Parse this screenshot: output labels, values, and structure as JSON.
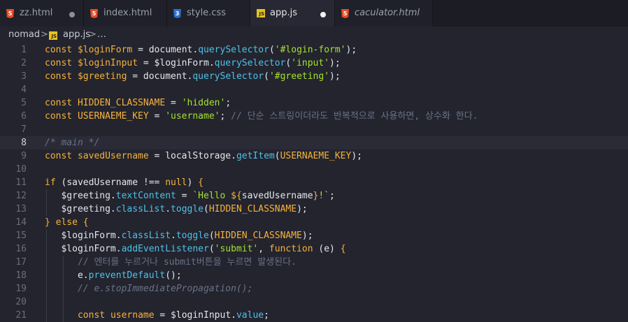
{
  "tabs": [
    {
      "name": "tab-zz-html",
      "label": "zz.html",
      "icon": "html5-icon",
      "modified": true,
      "italic": false,
      "active": false
    },
    {
      "name": "tab-index-html",
      "label": "index.html",
      "icon": "html5-icon",
      "modified": false,
      "italic": false,
      "active": false
    },
    {
      "name": "tab-style-css",
      "label": "style.css",
      "icon": "css3-icon",
      "modified": false,
      "italic": false,
      "active": false
    },
    {
      "name": "tab-app-js",
      "label": "app.js",
      "icon": "js-icon",
      "modified": true,
      "italic": false,
      "active": true
    },
    {
      "name": "tab-caculator-html",
      "label": "caculator.html",
      "icon": "html5-icon",
      "modified": false,
      "italic": true,
      "active": false
    }
  ],
  "breadcrumb": {
    "folder": "nomad",
    "file": "app.js",
    "more": "…",
    "separator": ">"
  },
  "editor": {
    "current_line": 8,
    "lines": [
      {
        "n": "1",
        "tokens": [
          [
            "kw",
            "const "
          ],
          [
            "vr",
            "$loginForm"
          ],
          [
            "op",
            " = "
          ],
          [
            "id",
            "document."
          ],
          [
            "fn",
            "querySelector"
          ],
          [
            "op",
            "("
          ],
          [
            "st",
            "'#login-form'"
          ],
          [
            "op",
            ");"
          ]
        ]
      },
      {
        "n": "2",
        "tokens": [
          [
            "kw",
            "const "
          ],
          [
            "vr",
            "$loginInput"
          ],
          [
            "op",
            " = "
          ],
          [
            "id",
            "$loginForm."
          ],
          [
            "fn",
            "querySelector"
          ],
          [
            "op",
            "("
          ],
          [
            "st",
            "'input'"
          ],
          [
            "op",
            ");"
          ]
        ]
      },
      {
        "n": "3",
        "tokens": [
          [
            "kw",
            "const "
          ],
          [
            "vr",
            "$greeting"
          ],
          [
            "op",
            " = "
          ],
          [
            "id",
            "document."
          ],
          [
            "fn",
            "querySelector"
          ],
          [
            "op",
            "("
          ],
          [
            "st",
            "'#greeting'"
          ],
          [
            "op",
            ");"
          ]
        ]
      },
      {
        "n": "4",
        "tokens": []
      },
      {
        "n": "5",
        "tokens": [
          [
            "kw",
            "const "
          ],
          [
            "vr",
            "HIDDEN_CLASSNAME"
          ],
          [
            "op",
            " = "
          ],
          [
            "st",
            "'hidden'"
          ],
          [
            "op",
            ";"
          ]
        ]
      },
      {
        "n": "6",
        "tokens": [
          [
            "kw",
            "const "
          ],
          [
            "vr",
            "USERNAEME_KEY"
          ],
          [
            "op",
            " = "
          ],
          [
            "st",
            "'username'"
          ],
          [
            "op",
            "; "
          ],
          [
            "cmko",
            "// 단순 스트링이더라도 반복적으로 사용하면, 상수화 한다."
          ]
        ]
      },
      {
        "n": "7",
        "tokens": []
      },
      {
        "n": "8",
        "tokens": [
          [
            "cm",
            "/* main */"
          ]
        ]
      },
      {
        "n": "9",
        "tokens": [
          [
            "kw",
            "const "
          ],
          [
            "vr",
            "savedUsername"
          ],
          [
            "op",
            " = "
          ],
          [
            "id",
            "localStorage."
          ],
          [
            "fn",
            "getItem"
          ],
          [
            "op",
            "("
          ],
          [
            "vr",
            "USERNAEME_KEY"
          ],
          [
            "op",
            ");"
          ]
        ]
      },
      {
        "n": "10",
        "tokens": []
      },
      {
        "n": "11",
        "tokens": [
          [
            "kw",
            "if "
          ],
          [
            "op",
            "("
          ],
          [
            "id",
            "savedUsername "
          ],
          [
            "op",
            "!== "
          ],
          [
            "kw",
            "null"
          ],
          [
            "op",
            ") "
          ],
          [
            "br",
            "{"
          ]
        ]
      },
      {
        "n": "12",
        "tokens": [
          [
            "op",
            "   "
          ],
          [
            "id",
            "$greeting."
          ],
          [
            "fn",
            "textContent"
          ],
          [
            "op",
            " = "
          ],
          [
            "st",
            "`Hello "
          ],
          [
            "kw",
            "${"
          ],
          [
            "id",
            "savedUsername"
          ],
          [
            "kw",
            "}"
          ],
          [
            "st",
            "!`"
          ],
          [
            "op",
            ";"
          ]
        ]
      },
      {
        "n": "13",
        "tokens": [
          [
            "op",
            "   "
          ],
          [
            "id",
            "$greeting."
          ],
          [
            "fn",
            "classList"
          ],
          [
            "op",
            "."
          ],
          [
            "fn",
            "toggle"
          ],
          [
            "op",
            "("
          ],
          [
            "vr",
            "HIDDEN_CLASSNAME"
          ],
          [
            "op",
            ");"
          ]
        ]
      },
      {
        "n": "14",
        "tokens": [
          [
            "br",
            "}"
          ],
          [
            "kw",
            " else "
          ],
          [
            "br",
            "{"
          ]
        ]
      },
      {
        "n": "15",
        "tokens": [
          [
            "op",
            "   "
          ],
          [
            "id",
            "$loginForm."
          ],
          [
            "fn",
            "classList"
          ],
          [
            "op",
            "."
          ],
          [
            "fn",
            "toggle"
          ],
          [
            "op",
            "("
          ],
          [
            "vr",
            "HIDDEN_CLASSNAME"
          ],
          [
            "op",
            ");"
          ]
        ]
      },
      {
        "n": "16",
        "tokens": [
          [
            "op",
            "   "
          ],
          [
            "id",
            "$loginForm."
          ],
          [
            "fn",
            "addEventListener"
          ],
          [
            "op",
            "("
          ],
          [
            "st",
            "'submit'"
          ],
          [
            "op",
            ", "
          ],
          [
            "kw",
            "function "
          ],
          [
            "op",
            "("
          ],
          [
            "id",
            "e"
          ],
          [
            "op",
            ") "
          ],
          [
            "br",
            "{"
          ]
        ]
      },
      {
        "n": "17",
        "tokens": [
          [
            "op",
            "      "
          ],
          [
            "cmko",
            "// 엔터를 누르거나 submit버튼을 누르면 발생된다."
          ]
        ]
      },
      {
        "n": "18",
        "tokens": [
          [
            "op",
            "      "
          ],
          [
            "id",
            "e."
          ],
          [
            "fn",
            "preventDefault"
          ],
          [
            "op",
            "();"
          ]
        ]
      },
      {
        "n": "19",
        "tokens": [
          [
            "op",
            "      "
          ],
          [
            "cm",
            "// e.stopImmediatePropagation();"
          ]
        ]
      },
      {
        "n": "20",
        "tokens": []
      },
      {
        "n": "21",
        "tokens": [
          [
            "op",
            "      "
          ],
          [
            "kw",
            "const "
          ],
          [
            "vr",
            "username"
          ],
          [
            "op",
            " = "
          ],
          [
            "id",
            "$loginInput."
          ],
          [
            "fn",
            "value"
          ],
          [
            "op",
            ";"
          ]
        ]
      }
    ]
  }
}
